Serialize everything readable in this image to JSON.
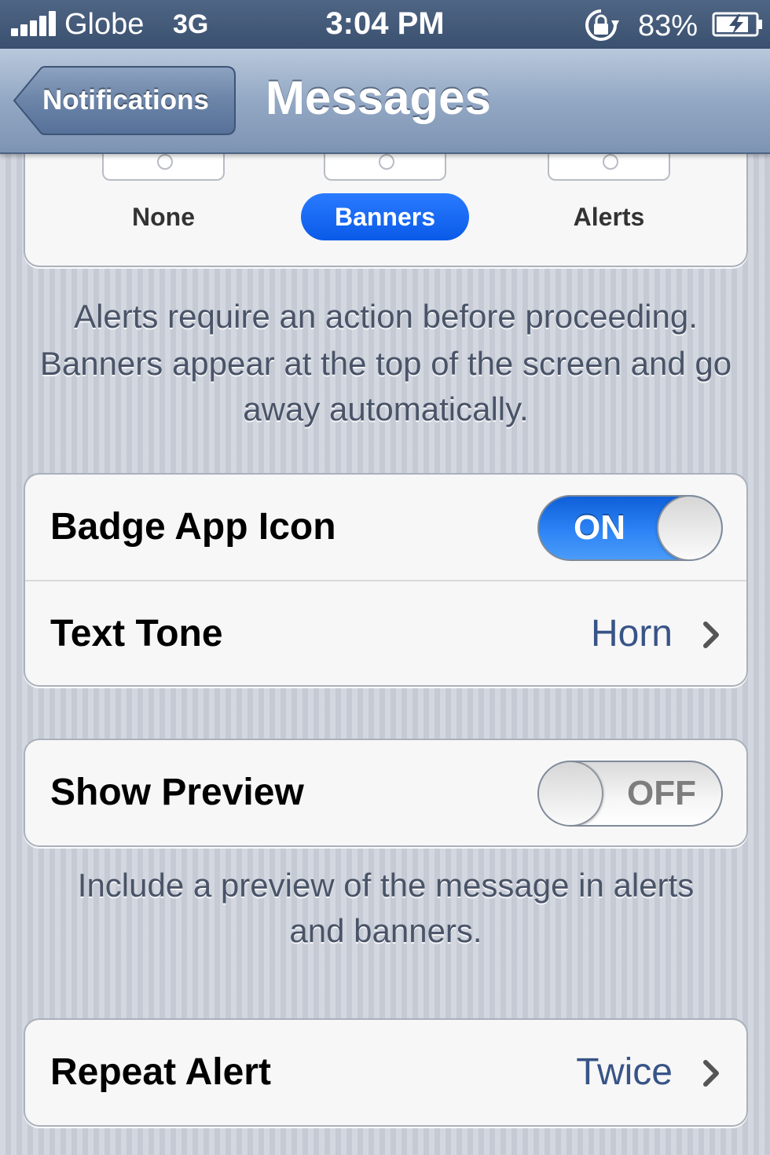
{
  "status_bar": {
    "carrier": "Globe",
    "network": "3G",
    "time": "3:04 PM",
    "battery": "83%",
    "icons": [
      "signal-bars-icon",
      "orientation-lock-icon",
      "battery-charging-icon"
    ]
  },
  "nav": {
    "back_label": "Notifications",
    "title": "Messages"
  },
  "alert_style": {
    "options": [
      "None",
      "Banners",
      "Alerts"
    ],
    "selected": "Banners",
    "accent_color": "#0a63f2"
  },
  "alert_style_footer": {
    "line1": "Alerts require an action before proceeding.",
    "line2": "Banners appear at the top of the screen and go away automatically."
  },
  "settings": {
    "badge_app_icon": {
      "label": "Badge App Icon",
      "state": "ON"
    },
    "text_tone": {
      "label": "Text Tone",
      "value": "Horn"
    },
    "show_preview": {
      "label": "Show Preview",
      "state": "OFF"
    },
    "show_preview_footer": "Include a preview of the message in alerts and banners.",
    "repeat_alert": {
      "label": "Repeat Alert",
      "value": "Twice"
    }
  },
  "colors": {
    "nav_bar": "#8fa4c1",
    "value_text": "#385487",
    "toggle_on": "#2d84f5"
  }
}
